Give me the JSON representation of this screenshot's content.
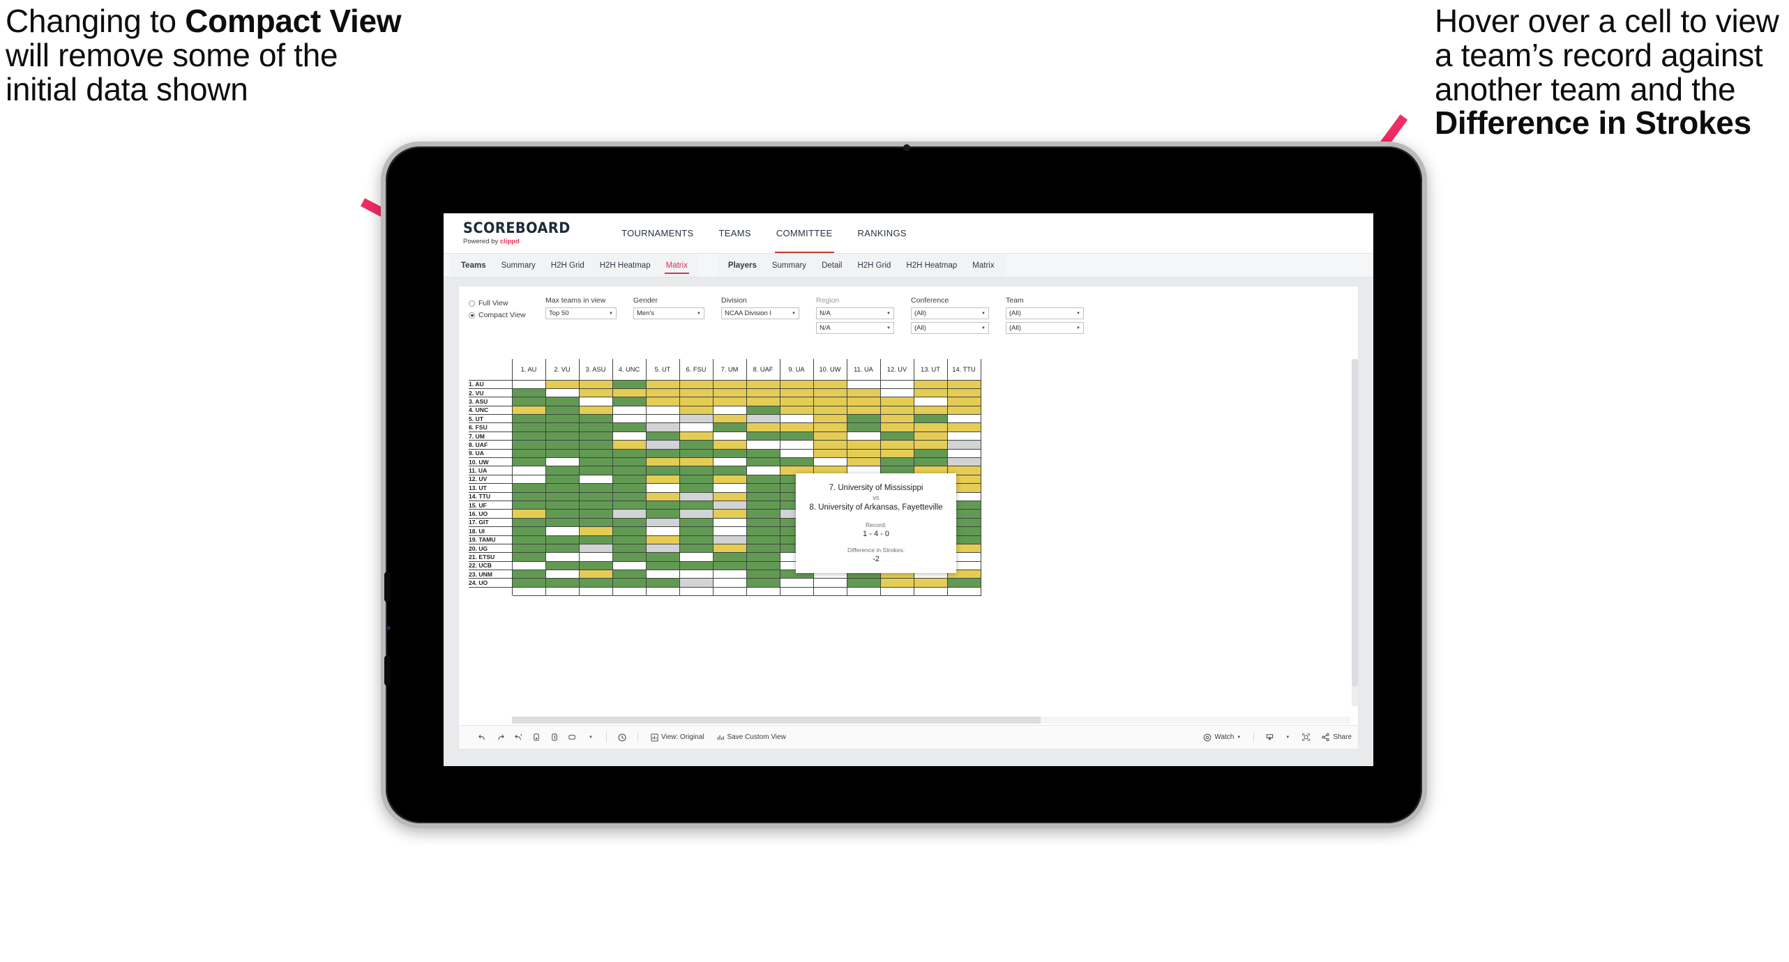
{
  "annotations": {
    "left": {
      "pre": "Changing to ",
      "bold": "Compact View",
      "post": " will remove some of the initial data shown"
    },
    "right": {
      "pre": "Hover over a cell to view a team’s record against another team and the ",
      "bold": "Difference in Strokes",
      "post": ""
    },
    "arrow_color": "#ef2d64"
  },
  "app": {
    "brand": {
      "name": "SCOREBOARD",
      "powered_prefix": "Powered by ",
      "powered_name": "clippd"
    },
    "topnav": [
      {
        "label": "TOURNAMENTS",
        "active": false
      },
      {
        "label": "TEAMS",
        "active": false
      },
      {
        "label": "COMMITTEE",
        "active": true
      },
      {
        "label": "RANKINGS",
        "active": false
      }
    ],
    "subnav_teams": {
      "head": "Teams",
      "items": [
        "Summary",
        "H2H Grid",
        "H2H Heatmap",
        "Matrix"
      ],
      "active": "Matrix"
    },
    "subnav_players": {
      "head": "Players",
      "items": [
        "Summary",
        "Detail",
        "H2H Grid",
        "H2H Heatmap",
        "Matrix"
      ],
      "active": ""
    }
  },
  "filters": {
    "view_mode": {
      "options": [
        "Full View",
        "Compact View"
      ],
      "selected": "Compact View"
    },
    "controls": [
      {
        "label": "Max teams in view",
        "value": "Top 50",
        "muted": false,
        "second": null
      },
      {
        "label": "Gender",
        "value": "Men's",
        "muted": false,
        "second": null
      },
      {
        "label": "Division",
        "value": "NCAA Division I",
        "muted": false,
        "second": null
      },
      {
        "label": "Region",
        "value": "N/A",
        "muted": true,
        "second": "N/A"
      },
      {
        "label": "Conference",
        "value": "(All)",
        "muted": false,
        "second": "(All)"
      },
      {
        "label": "Team",
        "value": "(All)",
        "muted": false,
        "second": "(All)"
      }
    ]
  },
  "matrix": {
    "columns": [
      "1. AU",
      "2. VU",
      "3. ASU",
      "4. UNC",
      "5. UT",
      "6. FSU",
      "7. UM",
      "8. UAF",
      "9. UA",
      "10. UW",
      "11. UA",
      "12. UV",
      "13. UT",
      "14. TTU"
    ],
    "rows": [
      "1. AU",
      "2. VU",
      "3. ASU",
      "4. UNC",
      "5. UT",
      "6. FSU",
      "7. UM",
      "8. UAF",
      "9. UA",
      "10. UW",
      "11. UA",
      "12. UV",
      "13. UT",
      "14. TTU",
      "15. UF",
      "16. UO",
      "17. GIT",
      "18. UI",
      "19. TAMU",
      "20. UG",
      "21. ETSU",
      "22. UCB",
      "23. UNM",
      "24. UO"
    ],
    "legend": {
      "green": "#629a53",
      "yellow": "#e5cc55",
      "white": "#ffffff",
      "grey": "#d2d3d5"
    },
    "cells": [
      [
        "w",
        "y",
        "y",
        "g",
        "y",
        "y",
        "y",
        "y",
        "y",
        "y",
        "w",
        "w",
        "y",
        "y"
      ],
      [
        "g",
        "w",
        "y",
        "y",
        "y",
        "y",
        "y",
        "y",
        "y",
        "y",
        "y",
        "w",
        "y",
        "y"
      ],
      [
        "g",
        "g",
        "w",
        "g",
        "y",
        "y",
        "y",
        "y",
        "y",
        "y",
        "y",
        "y",
        "w",
        "y"
      ],
      [
        "y",
        "g",
        "y",
        "w",
        "w",
        "y",
        "w",
        "g",
        "y",
        "y",
        "y",
        "y",
        "y",
        "y"
      ],
      [
        "g",
        "g",
        "g",
        "w",
        "w",
        "s",
        "y",
        "s",
        "w",
        "y",
        "g",
        "y",
        "g",
        "w"
      ],
      [
        "g",
        "g",
        "g",
        "g",
        "s",
        "w",
        "g",
        "y",
        "y",
        "y",
        "g",
        "y",
        "y",
        "y"
      ],
      [
        "g",
        "g",
        "g",
        "w",
        "g",
        "y",
        "w",
        "g",
        "g",
        "y",
        "w",
        "g",
        "y",
        "w"
      ],
      [
        "g",
        "g",
        "g",
        "y",
        "s",
        "g",
        "y",
        "w",
        "w",
        "y",
        "y",
        "y",
        "y",
        "s"
      ],
      [
        "g",
        "g",
        "g",
        "g",
        "g",
        "g",
        "g",
        "g",
        "w",
        "y",
        "y",
        "y",
        "g",
        "w"
      ],
      [
        "g",
        "w",
        "g",
        "g",
        "y",
        "y",
        "w",
        "g",
        "g",
        "w",
        "y",
        "g",
        "g",
        "s"
      ],
      [
        "w",
        "g",
        "g",
        "g",
        "g",
        "g",
        "g",
        "w",
        "y",
        "y",
        "w",
        "g",
        "y",
        "y"
      ],
      [
        "w",
        "g",
        "w",
        "g",
        "y",
        "g",
        "y",
        "g",
        "g",
        "w",
        "w",
        "w",
        "y",
        "y"
      ],
      [
        "g",
        "g",
        "g",
        "g",
        "w",
        "g",
        "w",
        "g",
        "g",
        "g",
        "w",
        "w",
        "w",
        "y"
      ],
      [
        "g",
        "g",
        "g",
        "g",
        "y",
        "s",
        "y",
        "g",
        "g",
        "y",
        "s",
        "w",
        "g",
        "w"
      ],
      [
        "g",
        "g",
        "g",
        "g",
        "g",
        "g",
        "s",
        "g",
        "g",
        "y",
        "g",
        "w",
        "w",
        "g"
      ],
      [
        "y",
        "g",
        "g",
        "s",
        "g",
        "s",
        "y",
        "g",
        "s",
        "g",
        "g",
        "y",
        "s",
        "g"
      ],
      [
        "g",
        "g",
        "g",
        "g",
        "s",
        "g",
        "w",
        "g",
        "g",
        "w",
        "g",
        "g",
        "g",
        "g"
      ],
      [
        "g",
        "w",
        "y",
        "g",
        "w",
        "g",
        "w",
        "g",
        "g",
        "y",
        "g",
        "w",
        "w",
        "g"
      ],
      [
        "g",
        "g",
        "g",
        "g",
        "y",
        "g",
        "s",
        "g",
        "g",
        "g",
        "g",
        "g",
        "y",
        "g"
      ],
      [
        "g",
        "g",
        "s",
        "g",
        "s",
        "g",
        "y",
        "g",
        "g",
        "g",
        "w",
        "w",
        "g",
        "y"
      ],
      [
        "g",
        "w",
        "w",
        "g",
        "g",
        "w",
        "g",
        "g",
        "w",
        "w",
        "y",
        "g",
        "g",
        "w"
      ],
      [
        "w",
        "g",
        "g",
        "w",
        "g",
        "g",
        "g",
        "g",
        "w",
        "w",
        "w",
        "w",
        "y",
        "w"
      ],
      [
        "g",
        "w",
        "y",
        "g",
        "w",
        "w",
        "w",
        "g",
        "g",
        "w",
        "g",
        "y",
        "w",
        "y"
      ],
      [
        "g",
        "g",
        "g",
        "g",
        "g",
        "s",
        "w",
        "g",
        "w",
        "w",
        "g",
        "y",
        "y",
        "g"
      ]
    ]
  },
  "tooltip": {
    "team_a": "7. University of Mississippi",
    "vs": "vs",
    "team_b": "8. University of Arkansas, Fayetteville",
    "record_label": "Record:",
    "record_value": "1 - 4 - 0",
    "strokes_label": "Difference in Strokes:",
    "strokes_value": "-2"
  },
  "toolbar": {
    "view_original": "View: Original",
    "save_custom": "Save Custom View",
    "watch": "Watch",
    "share": "Share"
  }
}
